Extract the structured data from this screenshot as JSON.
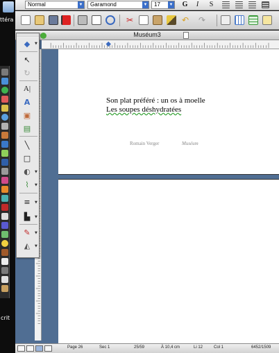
{
  "desktop": {
    "label_top": "ttéra",
    "label_bottom": "crit"
  },
  "format_toolbar": {
    "style_value": "Normal",
    "font_value": "Garamond",
    "size_value": "17",
    "bold_label": "G",
    "italic_label": "I",
    "underline_label": "S"
  },
  "window": {
    "title": "Muséum3"
  },
  "document": {
    "line1": "Son plat préféré : un os à moelle",
    "line2": "Les soupes déshydratées",
    "footer_author": "Romain Verger",
    "footer_doc": "Muséum"
  },
  "status_bar": {
    "page": "Page 26",
    "section": "Sec 1",
    "page_of": "25/59",
    "position": "À 10,4 cm",
    "line": "Li 12",
    "column": "Col 1",
    "word_count": "6452/1509"
  },
  "colors": {
    "window_bg": "#506e93",
    "spell_underline": "#2d9e2d",
    "accent_select": "#3b6fc9"
  }
}
